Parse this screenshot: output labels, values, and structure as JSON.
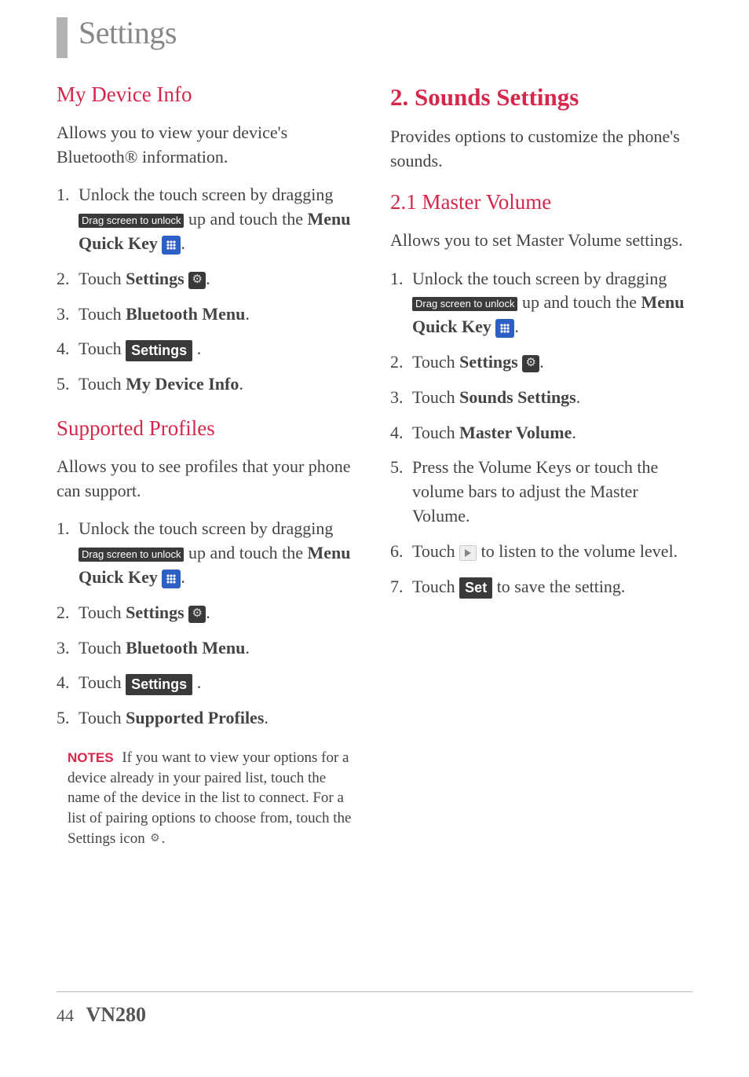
{
  "pageTitle": "Settings",
  "footer": {
    "pageNum": "44",
    "model": "VN280"
  },
  "labels": {
    "dragUnlock": "Drag screen to unlock",
    "settingsBtn": "Settings",
    "setBtn": "Set",
    "notes": "NOTES"
  },
  "left": {
    "h1": "My Device Info",
    "p1": "Allows you to view your device's Bluetooth® information.",
    "steps1": {
      "s1a": "Unlock the touch screen by dragging ",
      "s1b": " up and touch the ",
      "s1c": "Menu Quick Key",
      "s2a": "Touch ",
      "s2b": "Settings",
      "s3a": "Touch ",
      "s3b": "Bluetooth Menu",
      "s4a": "Touch ",
      "s5a": "Touch ",
      "s5b": "My Device Info"
    },
    "h2": "Supported Profiles",
    "p2": "Allows you to see profiles that your phone can support.",
    "steps2": {
      "s1a": "Unlock the touch screen by dragging ",
      "s1b": " up and touch the ",
      "s1c": "Menu Quick Key",
      "s2a": "Touch ",
      "s2b": "Settings",
      "s3a": "Touch ",
      "s3b": "Bluetooth Menu",
      "s4a": "Touch ",
      "s5a": "Touch ",
      "s5b": "Supported Profiles"
    },
    "notesText": "If you want to view your options for a device already in your paired list, touch the name of the device in the list to connect. For a list of pairing options to choose from, touch the Settings icon "
  },
  "right": {
    "h1": "2. Sounds Settings",
    "p1": "Provides options to customize the phone's sounds.",
    "h2": "2.1 Master Volume",
    "p2": "Allows you to set Master Volume settings.",
    "steps": {
      "s1a": "Unlock the touch screen by dragging ",
      "s1b": " up and touch the ",
      "s1c": "Menu Quick Key",
      "s2a": "Touch ",
      "s2b": "Settings",
      "s3a": "Touch ",
      "s3b": "Sounds Settings",
      "s4a": "Touch ",
      "s4b": "Master Volume",
      "s5": "Press the Volume Keys or touch the volume bars to adjust the Master Volume.",
      "s6a": "Touch ",
      "s6b": " to listen to the volume level.",
      "s7a": "Touch ",
      "s7b": " to save the setting."
    }
  }
}
